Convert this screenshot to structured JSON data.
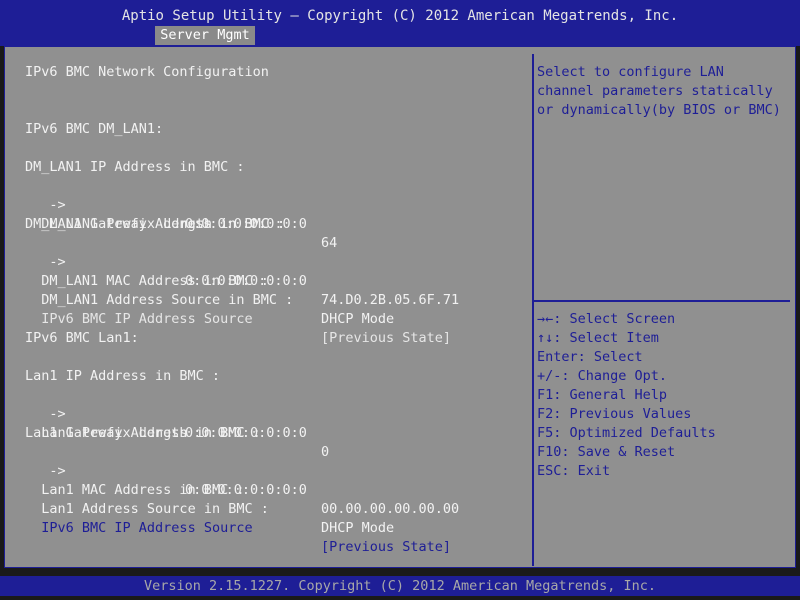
{
  "header": {
    "title": "Aptio Setup Utility – Copyright (C) 2012 American Megatrends, Inc.",
    "tab": "Server Mgmt"
  },
  "main": {
    "heading": "IPv6 BMC Network Configuration",
    "dm_section": "IPv6 BMC DM_LAN1:",
    "dm_ip_label": "DM_LAN1 IP Address in BMC :",
    "dm_ip_value": "0:0:0:0:0:0:0:0",
    "dm_prefix_label": "DM_LAN1 Prefix Length in BMC :",
    "dm_prefix_value": "64",
    "dm_gateway_label": "DM_LAN1 Gateway Address in BMC :",
    "dm_gateway_value": "0:0:0:0:0:0:0:0",
    "dm_mac_label": "DM_LAN1 MAC Address in BMC :",
    "dm_mac_value": "74.D0.2B.05.6F.71",
    "dm_source_label": "DM_LAN1 Address Source in BMC :",
    "dm_source_value": "DHCP Mode",
    "dm_ipsrc_label": "IPv6 BMC IP Address Source",
    "dm_ipsrc_value": "[Previous State]",
    "lan_section": "IPv6 BMC Lan1:",
    "lan_ip_label": "Lan1 IP Address in BMC :",
    "lan_ip_value": "0:0:0:0:0:0:0:0",
    "lan_prefix_label": "Lan1 Prefix Length in BMC :",
    "lan_prefix_value": "0",
    "lan_gateway_label": "Lan1 Gateway Address in BMC :",
    "lan_gateway_value": "0:0:0:0:0:0:0:0",
    "lan_mac_label": "Lan1 MAC Address in BMC :",
    "lan_mac_value": "00.00.00.00.00.00",
    "lan_source_label": "Lan1 Address Source in BMC :",
    "lan_source_value": "DHCP Mode",
    "lan_ipsrc_label": "IPv6 BMC IP Address Source",
    "lan_ipsrc_value": "[Previous State]",
    "arrow": " ->"
  },
  "help": {
    "line1": "Select to configure LAN",
    "line2": "channel parameters statically",
    "line3": "or dynamically(by BIOS or BMC)"
  },
  "keys": [
    "→←: Select Screen",
    "↑↓: Select Item",
    "Enter: Select",
    "+/-: Change Opt.",
    "F1: General Help",
    "F2: Previous Values",
    "F5: Optimized Defaults",
    "F10: Save & Reset",
    "ESC: Exit"
  ],
  "footer": {
    "version": "Version 2.15.1227. Copyright (C) 2012 American Megatrends, Inc."
  },
  "colors": {
    "frame": "#1e1e96",
    "panel": "#909090",
    "text": "#f2f2f2",
    "highlight": "#1e1e96"
  }
}
